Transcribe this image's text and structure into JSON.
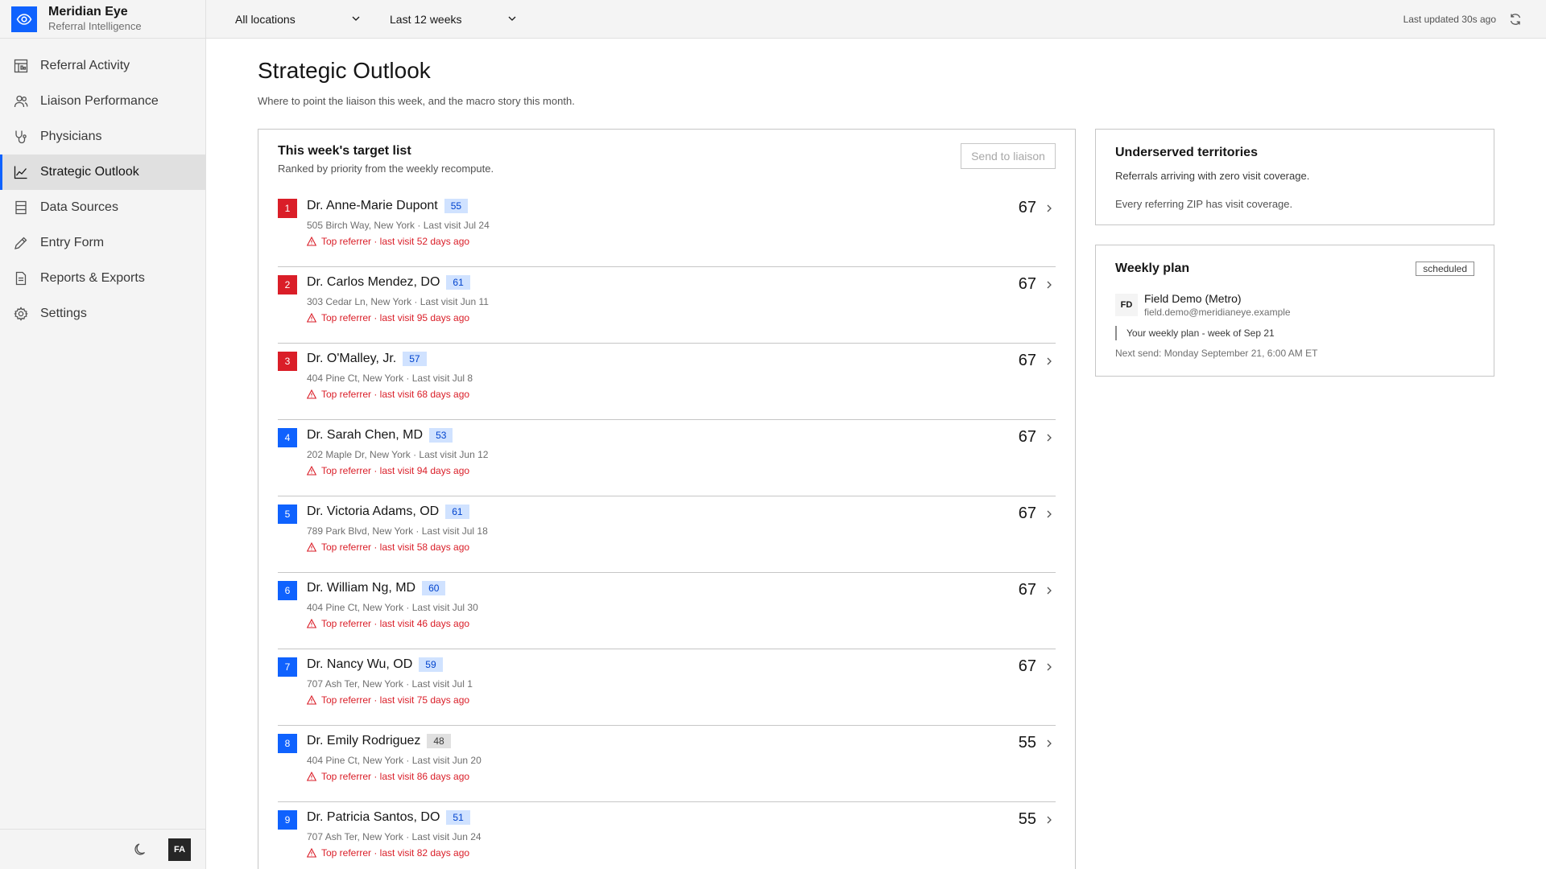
{
  "brand": {
    "name": "Meridian Eye",
    "subtitle": "Referral Intelligence"
  },
  "nav": {
    "items": [
      {
        "label": "Referral Activity",
        "icon": "activity-grid-icon",
        "active": false
      },
      {
        "label": "Liaison Performance",
        "icon": "people-icon",
        "active": false
      },
      {
        "label": "Physicians",
        "icon": "stethoscope-icon",
        "active": false
      },
      {
        "label": "Strategic Outlook",
        "icon": "line-chart-icon",
        "active": true
      },
      {
        "label": "Data Sources",
        "icon": "database-icon",
        "active": false
      },
      {
        "label": "Entry Form",
        "icon": "pen-icon",
        "active": false
      },
      {
        "label": "Reports & Exports",
        "icon": "document-icon",
        "active": false
      },
      {
        "label": "Settings",
        "icon": "gear-icon",
        "active": false
      }
    ]
  },
  "footer": {
    "avatar_initials": "FA",
    "theme_icon": "moon-icon"
  },
  "topbar": {
    "location_filter": "All locations",
    "range_filter": "Last 12 weeks",
    "last_updated": "Last updated 30s ago"
  },
  "page": {
    "title": "Strategic Outlook",
    "subtitle": "Where to point the liaison this week, and the macro story this month."
  },
  "target_list": {
    "title": "This week's target list",
    "subtitle": "Ranked by priority from the weekly recompute.",
    "send_label": "Send to liaison",
    "rows": [
      {
        "rank": "1",
        "rank_color": "red",
        "name": "Dr. Anne-Marie Dupont",
        "tag": "55",
        "tag_color": "blue",
        "address": "505 Birch Way, New York · Last visit Jul 24",
        "alert": "Top referrer · last visit 52 days ago",
        "score": "67"
      },
      {
        "rank": "2",
        "rank_color": "red",
        "name": "Dr. Carlos Mendez, DO",
        "tag": "61",
        "tag_color": "blue",
        "address": "303 Cedar Ln, New York · Last visit Jun 11",
        "alert": "Top referrer · last visit 95 days ago",
        "score": "67"
      },
      {
        "rank": "3",
        "rank_color": "red",
        "name": "Dr. O'Malley, Jr.",
        "tag": "57",
        "tag_color": "blue",
        "address": "404 Pine Ct, New York · Last visit Jul 8",
        "alert": "Top referrer · last visit 68 days ago",
        "score": "67"
      },
      {
        "rank": "4",
        "rank_color": "blue",
        "name": "Dr. Sarah Chen, MD",
        "tag": "53",
        "tag_color": "blue",
        "address": "202 Maple Dr, New York · Last visit Jun 12",
        "alert": "Top referrer · last visit 94 days ago",
        "score": "67"
      },
      {
        "rank": "5",
        "rank_color": "blue",
        "name": "Dr. Victoria Adams, OD",
        "tag": "61",
        "tag_color": "blue",
        "address": "789 Park Blvd, New York · Last visit Jul 18",
        "alert": "Top referrer · last visit 58 days ago",
        "score": "67"
      },
      {
        "rank": "6",
        "rank_color": "blue",
        "name": "Dr. William Ng, MD",
        "tag": "60",
        "tag_color": "blue",
        "address": "404 Pine Ct, New York · Last visit Jul 30",
        "alert": "Top referrer · last visit 46 days ago",
        "score": "67"
      },
      {
        "rank": "7",
        "rank_color": "blue",
        "name": "Dr. Nancy Wu, OD",
        "tag": "59",
        "tag_color": "blue",
        "address": "707 Ash Ter, New York · Last visit Jul 1",
        "alert": "Top referrer · last visit 75 days ago",
        "score": "67"
      },
      {
        "rank": "8",
        "rank_color": "blue",
        "name": "Dr. Emily Rodriguez",
        "tag": "48",
        "tag_color": "gray",
        "address": "404 Pine Ct, New York · Last visit Jun 20",
        "alert": "Top referrer · last visit 86 days ago",
        "score": "55"
      },
      {
        "rank": "9",
        "rank_color": "blue",
        "name": "Dr. Patricia Santos, DO",
        "tag": "51",
        "tag_color": "blue",
        "address": "707 Ash Ter, New York · Last visit Jun 24",
        "alert": "Top referrer · last visit 82 days ago",
        "score": "55"
      }
    ]
  },
  "underserved": {
    "title": "Underserved territories",
    "description": "Referrals arriving with zero visit coverage.",
    "note": "Every referring ZIP has visit coverage."
  },
  "weekly_plan": {
    "title": "Weekly plan",
    "status": "scheduled",
    "initials": "FD",
    "name": "Field Demo (Metro)",
    "email": "field.demo@meridianeye.example",
    "subject": "Your weekly plan - week of Sep 21",
    "next_send": "Next send: Monday September 21, 6:00 AM ET"
  },
  "colors": {
    "accent": "#0f62fe",
    "alert": "#da1e28",
    "tag_blue_bg": "#d0e2ff"
  }
}
